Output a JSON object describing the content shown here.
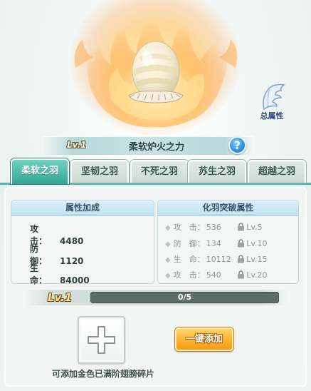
{
  "hero": {
    "total_attr_label": "总属性"
  },
  "header": {
    "level": "Lv.1",
    "title": "柔软炉火之力",
    "help_glyph": "?"
  },
  "tabs": [
    {
      "label": "柔软之羽",
      "active": true
    },
    {
      "label": "坚韧之羽",
      "active": false
    },
    {
      "label": "不死之羽",
      "active": false
    },
    {
      "label": "苏生之羽",
      "active": false
    },
    {
      "label": "超越之羽",
      "active": false
    }
  ],
  "attributes": {
    "title": "属性加成",
    "rows": [
      {
        "name": "攻　击：",
        "value": "4480"
      },
      {
        "name": "防　御：",
        "value": "1120"
      },
      {
        "name": "生　命：",
        "value": "84000"
      }
    ]
  },
  "breakthrough": {
    "title": "化羽突破属性",
    "rows": [
      {
        "name": "攻　击：",
        "value": "536",
        "unlock": "Lv.5"
      },
      {
        "name": "防　御：",
        "value": "134",
        "unlock": "Lv.10"
      },
      {
        "name": "生　命：",
        "value": "10112",
        "unlock": "Lv.15"
      },
      {
        "name": "攻　击：",
        "value": "540",
        "unlock": "Lv.20"
      }
    ]
  },
  "progress": {
    "level": "Lv.1",
    "text": "0/5",
    "fraction": 0
  },
  "actions": {
    "one_click_label": "一键添加",
    "hint": "可添加金色已满阶翅膀碎片"
  },
  "colors": {
    "accent_teal": "#33a696",
    "button_orange": "#ffb32b"
  }
}
